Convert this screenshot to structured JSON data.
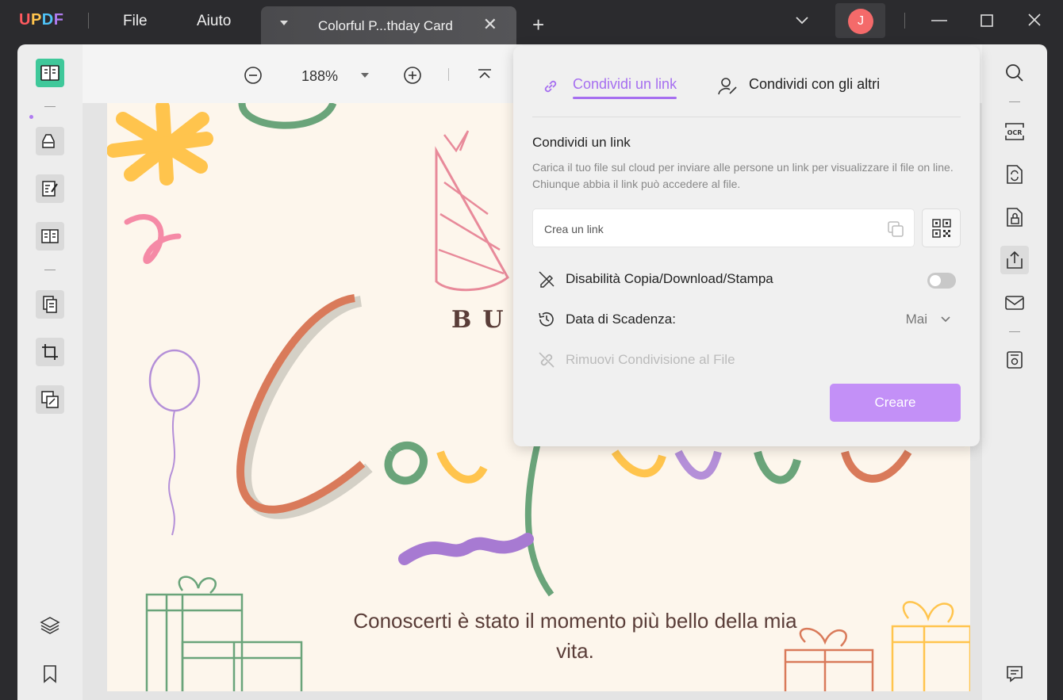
{
  "app": {
    "logo_u": "U",
    "logo_p": "P",
    "logo_d": "D",
    "logo_f": "F",
    "menu": [
      "File",
      "Aiuto"
    ]
  },
  "tab": {
    "title": "Colorful P...thday Card",
    "close": "✕"
  },
  "new_tab": "+",
  "user": {
    "initial": "J"
  },
  "toolbar": {
    "zoom": "188%"
  },
  "card": {
    "letters": "BU",
    "message": "Conoscerti è stato il momento più bello della mia vita."
  },
  "share": {
    "tab_link": "Condividi un link",
    "tab_others": "Condividi con gli altri",
    "heading": "Condividi un link",
    "description": "Carica il tuo file sul cloud per inviare alle persone un link per visualizzare il file on line. Chiunque abbia il link può accedere al file.",
    "link_placeholder": "Crea un link",
    "disable_copy_label": "Disabilità Copia/Download/Stampa",
    "disable_copy_enabled": false,
    "expiry_label": "Data di Scadenza:",
    "expiry_value": "Mai",
    "remove_label": "Rimuovi Condivisione al File",
    "create_button": "Creare"
  },
  "colors": {
    "accent": "#a66ff0",
    "button": "#c390f7",
    "avatar": "#f46a6a"
  }
}
